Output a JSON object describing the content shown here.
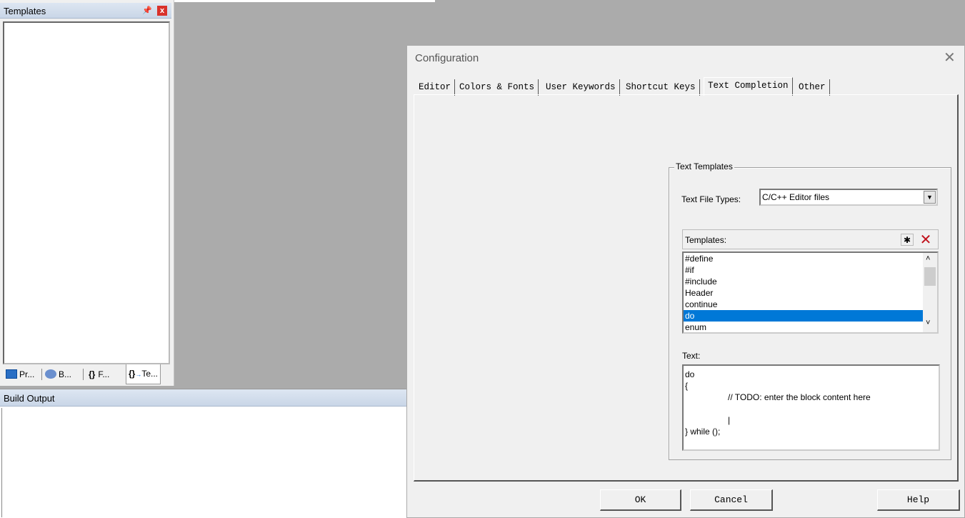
{
  "templates_pane": {
    "title": "Templates",
    "pin_icon": "pin-icon",
    "close_icon": "close-icon",
    "bottom_tabs": [
      {
        "label": "Pr...",
        "icon": "project-icon"
      },
      {
        "label": "B...",
        "icon": "books-icon"
      },
      {
        "label": "F...",
        "icon": "functions-icon"
      },
      {
        "label": "Te...",
        "icon": "templates-icon"
      }
    ]
  },
  "build_output": {
    "title": "Build Output"
  },
  "dialog": {
    "title": "Configuration",
    "tabs": [
      "Editor",
      "Colors & Fonts",
      "User Keywords",
      "Shortcut Keys",
      "Text Completion",
      "Other"
    ],
    "active_tab": "Text Completion",
    "group_title": "Text Templates",
    "file_types_label": "Text File Types:",
    "file_types_value": "C/C++ Editor files",
    "templates_label": "Templates:",
    "templates": [
      "#define",
      "#if",
      "#include",
      "Header",
      "continue",
      "do",
      "enum"
    ],
    "selected_template": "do",
    "text_label": "Text:",
    "text_lines": [
      "do",
      "{",
      "\t// TODO: enter the block content here",
      "",
      "\t|",
      "} while ();"
    ],
    "buttons": {
      "ok": "OK",
      "cancel": "Cancel",
      "help": "Help"
    },
    "colors": {
      "selection": "#0078d7",
      "delete_icon": "#c0111b"
    }
  }
}
